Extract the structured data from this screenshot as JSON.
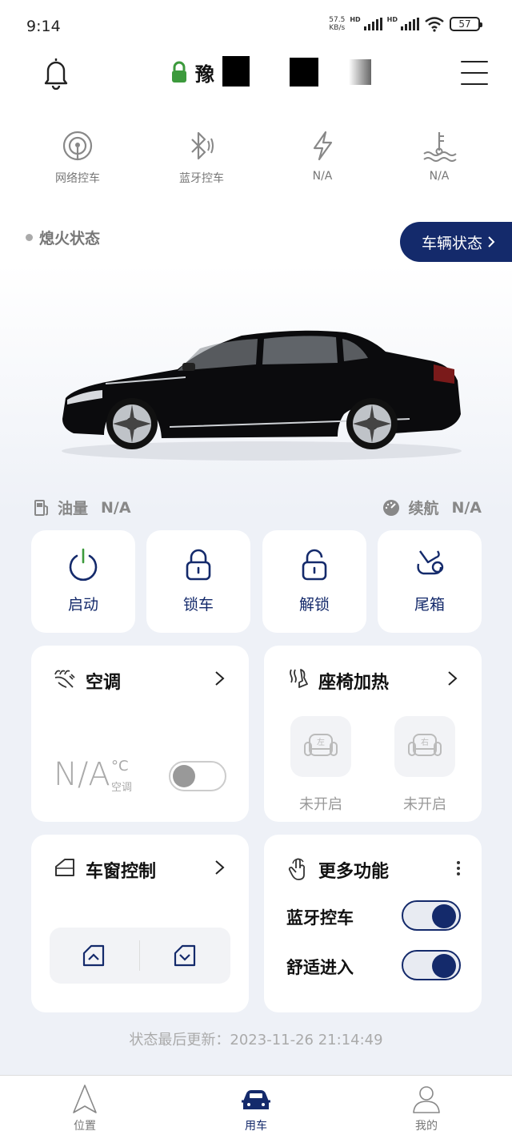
{
  "status_bar": {
    "time": "9:14",
    "speed_value": "57.5",
    "speed_unit": "KB/s",
    "hd1": "HD",
    "hd2": "HD",
    "wifi_sub": "7",
    "battery": "57"
  },
  "header": {
    "plate_char": "豫"
  },
  "quick_controls": [
    {
      "icon": "network-control-icon",
      "label": "网络控车"
    },
    {
      "icon": "bluetooth-control-icon",
      "label": "蓝牙控车"
    },
    {
      "icon": "lightning-icon",
      "label": "N/A"
    },
    {
      "icon": "coolant-temperature-icon",
      "label": "N/A"
    }
  ],
  "engine_status": "熄火状态",
  "vehicle_status_button": "车辆状态",
  "fuel": {
    "label": "油量",
    "value": "N/A"
  },
  "range": {
    "label": "续航",
    "value": "N/A"
  },
  "controls": [
    {
      "icon": "power-icon",
      "label": "启动"
    },
    {
      "icon": "lock-icon",
      "label": "锁车"
    },
    {
      "icon": "unlock-icon",
      "label": "解锁"
    },
    {
      "icon": "trunk-icon",
      "label": "尾箱"
    }
  ],
  "ac": {
    "title": "空调",
    "temp": "N/A",
    "unit": "°C",
    "sub": "空调",
    "on": false
  },
  "seat_heating": {
    "title": "座椅加热",
    "left_seat": "左",
    "right_seat": "右",
    "left_status": "未开启",
    "right_status": "未开启"
  },
  "window": {
    "title": "车窗控制"
  },
  "more": {
    "title": "更多功能",
    "options": [
      {
        "label": "蓝牙控车",
        "on": true
      },
      {
        "label": "舒适进入",
        "on": true
      }
    ]
  },
  "last_update": "状态最后更新：2023-11-26 21:14:49",
  "tabs": [
    {
      "label": "位置",
      "active": false
    },
    {
      "label": "用车",
      "active": true
    },
    {
      "label": "我的",
      "active": false
    }
  ],
  "colors": {
    "accent": "#142a6b",
    "lock_green": "#3c9a3c"
  }
}
